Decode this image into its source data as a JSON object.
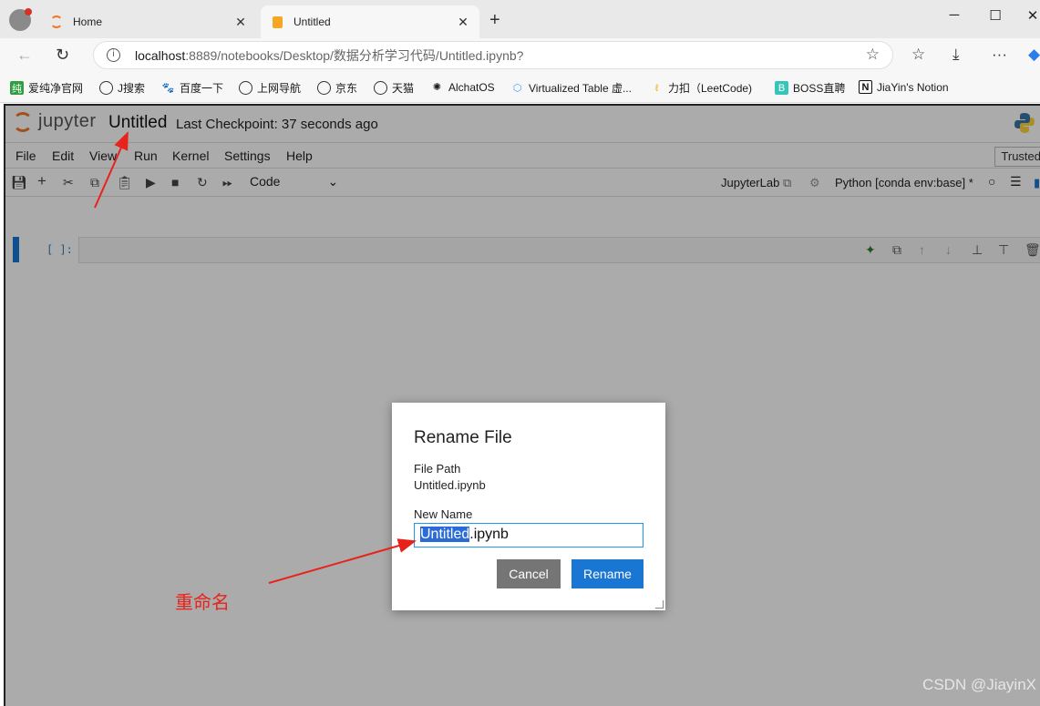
{
  "browser": {
    "tabs": [
      {
        "label": "Home",
        "icon": "jupyter-icon"
      },
      {
        "label": "Untitled",
        "icon": "notebook-icon"
      }
    ],
    "url_host": "localhost",
    "url_rest": ":8889/notebooks/Desktop/数据分析学习代码/Untitled.ipynb?",
    "bookmarks": [
      {
        "label": "爱纯净官网",
        "icon": "纯"
      },
      {
        "label": "J搜索",
        "icon": "globe"
      },
      {
        "label": "百度一下",
        "icon": "baidu"
      },
      {
        "label": "上网导航",
        "icon": "globe"
      },
      {
        "label": "京东",
        "icon": "globe"
      },
      {
        "label": "天猫",
        "icon": "globe"
      },
      {
        "label": "AlchatOS",
        "icon": "openai"
      },
      {
        "label": "Virtualized Table 虚...",
        "icon": "element"
      },
      {
        "label": "力扣（LeetCode)",
        "icon": "leetcode"
      },
      {
        "label": "BOSS直聘",
        "icon": "B"
      },
      {
        "label": "JiaYin's Notion",
        "icon": "N"
      }
    ]
  },
  "jupyter": {
    "wordmark": "jupyter",
    "notebook_title": "Untitled",
    "checkpoint": "Last Checkpoint: 37 seconds ago",
    "menu": [
      "File",
      "Edit",
      "View",
      "Run",
      "Kernel",
      "Settings",
      "Help"
    ],
    "trusted": "Trusted",
    "cell_type": "Code",
    "jupyterlab_link": "JupyterLab",
    "kernel": "Python [conda env:base] *",
    "cell_prompt": "[ ]:"
  },
  "dialog": {
    "title": "Rename File",
    "file_path_label": "File Path",
    "file_path_value": "Untitled.ipynb",
    "new_name_label": "New Name",
    "new_name_selected": "Untitled",
    "new_name_rest": ".ipynb",
    "cancel_label": "Cancel",
    "rename_label": "Rename"
  },
  "annotation": {
    "text": "重命名",
    "color": "#e8231b"
  },
  "watermark": "CSDN @JiayinX",
  "colors": {
    "accent": "#1976d2",
    "jupyter_orange": "#f37726"
  }
}
